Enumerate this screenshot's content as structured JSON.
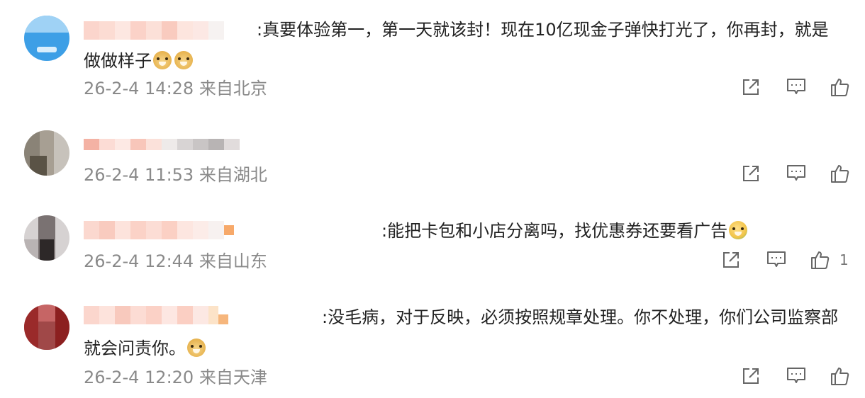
{
  "comments": [
    {
      "username": "",
      "separator": ":",
      "text": "真要体验第一，第一天就该封！现在10亿现金子弹快打光了，你再封，就是做做样子",
      "emojis": [
        "doge-emoji",
        "doge-emoji"
      ],
      "time": "26-2-4 14:28",
      "location": "来自北京",
      "like_count": ""
    },
    {
      "username": "",
      "separator": "",
      "text": "",
      "emojis": [],
      "time": "26-2-4 11:53",
      "location": "来自湖北",
      "like_count": ""
    },
    {
      "username": "",
      "separator": ":",
      "text": "能把卡包和小店分离吗，找优惠券还要看广告",
      "emojis": [
        "baby-emoji"
      ],
      "time": "26-2-4 12:44",
      "location": "来自山东",
      "like_count": "1"
    },
    {
      "username": "",
      "separator": ":",
      "text": "没毛病，对于反映，必须按照规章处理。你不处理，你们公司监察部就会问责你。",
      "emojis": [
        "doge-emoji"
      ],
      "time": "26-2-4 12:20",
      "location": "来自天津",
      "like_count": ""
    }
  ],
  "icons": {
    "share": "share-icon",
    "reply": "comment-icon",
    "like": "thumbs-up-icon"
  },
  "colors": {
    "text": "#222222",
    "meta": "#8a8a8a",
    "icon": "#666666"
  }
}
